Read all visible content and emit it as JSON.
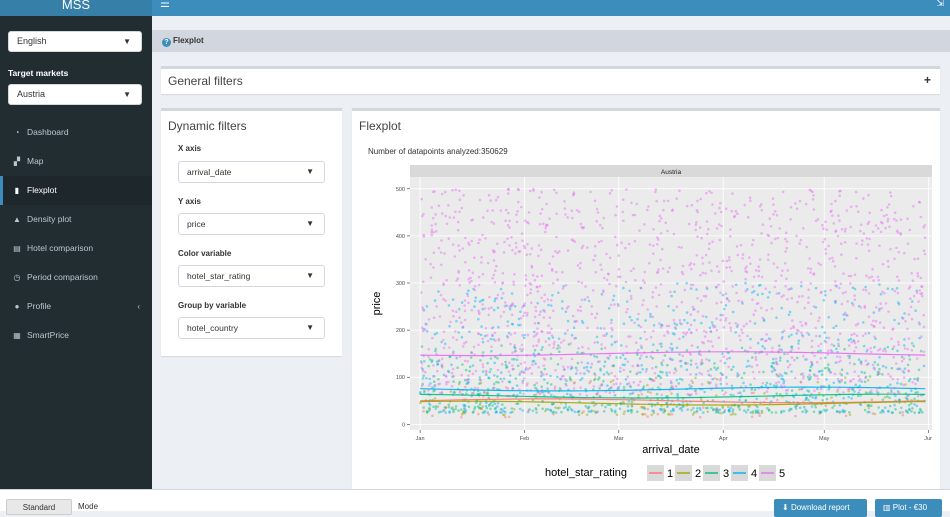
{
  "header": {
    "brand": "MSS",
    "menu_icon": "hamburger-icon",
    "right_icon": "share-icon"
  },
  "sidebar": {
    "language": "English",
    "target_markets_label": "Target markets",
    "market": "Austria",
    "items": [
      {
        "label": "Dashboard",
        "icon": "dashboard-icon"
      },
      {
        "label": "Map",
        "icon": "map-icon"
      },
      {
        "label": "Flexplot",
        "icon": "bar-chart-icon",
        "active": true
      },
      {
        "label": "Density plot",
        "icon": "area-chart-icon"
      },
      {
        "label": "Hotel comparison",
        "icon": "building-icon"
      },
      {
        "label": "Period comparison",
        "icon": "clock-icon"
      },
      {
        "label": "Profile",
        "icon": "user-icon"
      },
      {
        "label": "SmartPrice",
        "icon": "calculator-icon"
      }
    ]
  },
  "breadcrumb": {
    "label": "Flexplot",
    "icon": "question-icon"
  },
  "general_filters": {
    "title": "General filters",
    "toggle": "+"
  },
  "dynamic_filters": {
    "title": "Dynamic filters",
    "fields": [
      {
        "label": "X axis",
        "value": "arrival_date"
      },
      {
        "label": "Y axis",
        "value": "price"
      },
      {
        "label": "Color variable",
        "value": "hotel_star_rating"
      },
      {
        "label": "Group by variable",
        "value": "hotel_country"
      }
    ]
  },
  "plot": {
    "title": "Flexplot",
    "datapoints_text": "Number of datapoints analyzed:350629"
  },
  "chart_data": {
    "type": "scatter",
    "facet_label": "Austria",
    "xlabel": "arrival_date",
    "ylabel": "price",
    "x_tick_labels": [
      "Jan",
      "Feb",
      "Mar",
      "Apr",
      "May",
      "Jun"
    ],
    "x_ticks": [
      "2017-01-01",
      "2017-02-01",
      "2017-03-01",
      "2017-04-01",
      "2017-05-01",
      "2017-06-01"
    ],
    "xlim": [
      "2016-12-29",
      "2017-06-02"
    ],
    "y_ticks": [
      0,
      100,
      200,
      300,
      400,
      500
    ],
    "ylim": [
      -12,
      525
    ],
    "legend_title": "hotel_star_rating",
    "legend_position": "bottom",
    "series": [
      {
        "name": "1",
        "color": "#F8766D",
        "price_range": [
          15,
          80
        ],
        "trend": 50
      },
      {
        "name": "2",
        "color": "#A3A500",
        "price_range": [
          20,
          100
        ],
        "trend": 45
      },
      {
        "name": "3",
        "color": "#00BF7D",
        "price_range": [
          25,
          170
        ],
        "trend": 60
      },
      {
        "name": "4",
        "color": "#00B0F6",
        "price_range": [
          25,
          300
        ],
        "trend": 75
      },
      {
        "name": "5",
        "color": "#E76BF3",
        "price_range": [
          60,
          500
        ],
        "trend": 150
      }
    ],
    "grid": true
  },
  "footer": {
    "mode_button": "Standard",
    "mode_label": "Mode",
    "download_button": "Download report",
    "download_icon": "download-icon",
    "plot_button": "Plot - €30",
    "plot_icon": "chart-icon"
  },
  "colors": {
    "header": "#3c8dbc",
    "sidebar": "#222d32",
    "accent": "#3c8dbc",
    "panel_bg": "#ebebeb"
  }
}
